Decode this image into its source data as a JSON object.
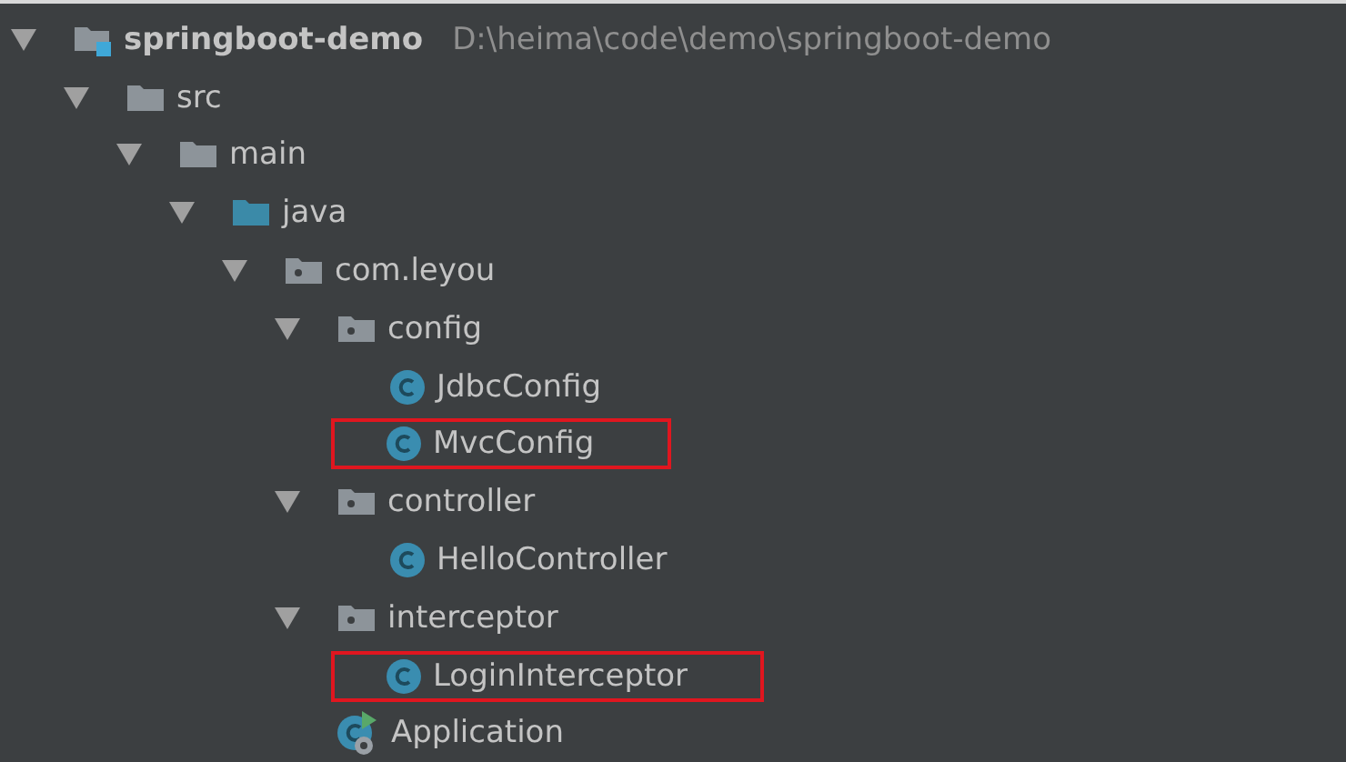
{
  "tree": [
    {
      "kind": "module",
      "label": "springboot-demo",
      "path": "D:\\heima\\code\\demo\\springboot-demo",
      "expanded": true,
      "highlighted": false,
      "children": [
        {
          "kind": "folder",
          "label": "src",
          "expanded": true,
          "highlighted": false,
          "children": [
            {
              "kind": "folder",
              "label": "main",
              "expanded": true,
              "highlighted": false,
              "children": [
                {
                  "kind": "source-folder",
                  "label": "java",
                  "expanded": true,
                  "highlighted": false,
                  "children": [
                    {
                      "kind": "package",
                      "label": "com.leyou",
                      "expanded": true,
                      "highlighted": false,
                      "children": [
                        {
                          "kind": "package",
                          "label": "config",
                          "expanded": true,
                          "highlighted": false,
                          "children": [
                            {
                              "kind": "class",
                              "label": "JdbcConfig",
                              "highlighted": false
                            },
                            {
                              "kind": "class",
                              "label": "MvcConfig",
                              "highlighted": true
                            }
                          ]
                        },
                        {
                          "kind": "package",
                          "label": "controller",
                          "expanded": true,
                          "highlighted": false,
                          "children": [
                            {
                              "kind": "class",
                              "label": "HelloController",
                              "highlighted": false
                            }
                          ]
                        },
                        {
                          "kind": "package",
                          "label": "interceptor",
                          "expanded": true,
                          "highlighted": false,
                          "children": [
                            {
                              "kind": "class",
                              "label": "LoginInterceptor",
                              "highlighted": true
                            }
                          ]
                        },
                        {
                          "kind": "app-class",
                          "label": "Application",
                          "highlighted": false
                        }
                      ]
                    }
                  ]
                }
              ]
            }
          ]
        }
      ]
    }
  ]
}
